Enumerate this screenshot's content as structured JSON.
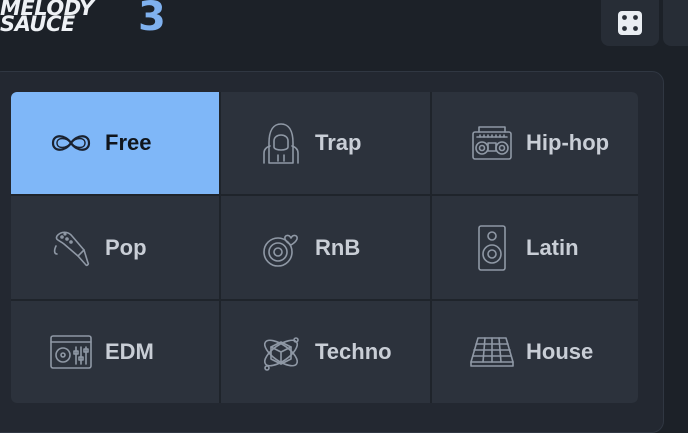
{
  "logo": {
    "line1": "MELODY",
    "line2": "SAUCE",
    "version": "3"
  },
  "topbar": {
    "randomize_icon": "dice-icon"
  },
  "genres": [
    {
      "label": "Free",
      "icon": "infinity-icon",
      "selected": true
    },
    {
      "label": "Trap",
      "icon": "hoodie-icon",
      "selected": false
    },
    {
      "label": "Hip-hop",
      "icon": "boombox-icon",
      "selected": false
    },
    {
      "label": "Pop",
      "icon": "popsicle-icon",
      "selected": false
    },
    {
      "label": "RnB",
      "icon": "vinyl-heart-icon",
      "selected": false
    },
    {
      "label": "Latin",
      "icon": "speaker-icon",
      "selected": false
    },
    {
      "label": "EDM",
      "icon": "dj-mixer-icon",
      "selected": false
    },
    {
      "label": "Techno",
      "icon": "atom-cube-icon",
      "selected": false
    },
    {
      "label": "House",
      "icon": "drum-pad-icon",
      "selected": false
    }
  ],
  "colors": {
    "accent": "#7fb7f8",
    "logo_number": "#7fb1ef",
    "tile": "#2c323c",
    "background": "#1c2128"
  }
}
